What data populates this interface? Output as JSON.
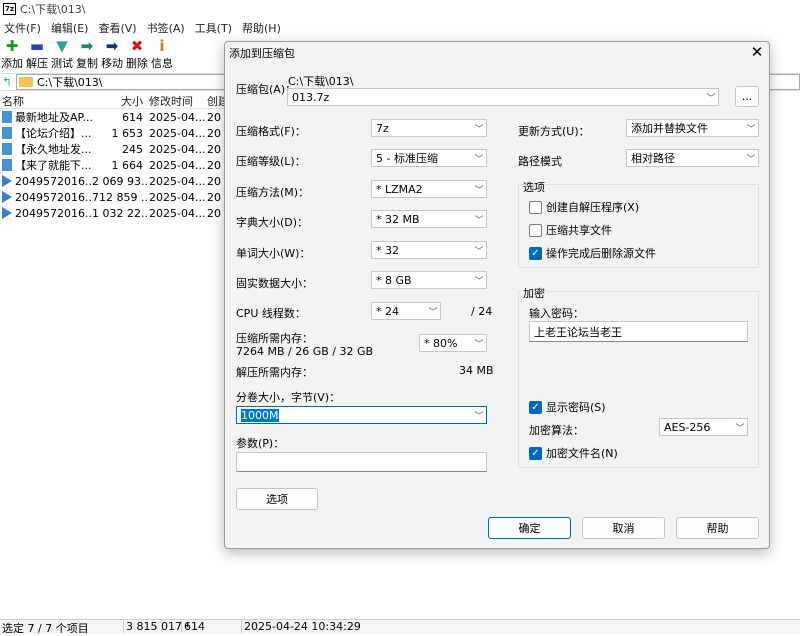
{
  "window": {
    "icon_label": "7z",
    "title": "C:\\下载\\013\\"
  },
  "menu": [
    "文件(F)",
    "编辑(E)",
    "查看(V)",
    "书签(A)",
    "工具(T)",
    "帮助(H)"
  ],
  "toolbar": [
    {
      "label": "添加",
      "glyph": "✚",
      "color": "#1a9e1a",
      "icon": "add-icon"
    },
    {
      "label": "解压",
      "glyph": "▬",
      "color": "#2a3fb0",
      "icon": "extract-icon"
    },
    {
      "label": "测试",
      "glyph": "▼",
      "color": "#2aa0a0",
      "icon": "test-icon"
    },
    {
      "label": "复制",
      "glyph": "➡",
      "color": "#1a8a6a",
      "icon": "copy-icon"
    },
    {
      "label": "移动",
      "glyph": "➡",
      "color": "#1a2a90",
      "icon": "move-icon"
    },
    {
      "label": "删除",
      "glyph": "✖",
      "color": "#d11a1a",
      "icon": "delete-icon"
    },
    {
      "label": "信息",
      "glyph": "i",
      "color": "#b8860b",
      "icon": "info-icon"
    }
  ],
  "address": {
    "path": "C:\\下载\\013\\"
  },
  "filelist": {
    "headers": [
      "名称",
      "大小",
      "修改时间",
      "创建"
    ],
    "rows": [
      {
        "name": "最新地址及AP...",
        "size": "614",
        "modified": "2025-04...",
        "created": "20",
        "type": "doc"
      },
      {
        "name": "【论坛介绍】....",
        "size": "1 653",
        "modified": "2025-04...",
        "created": "20",
        "type": "doc"
      },
      {
        "name": "【永久地址发...",
        "size": "245",
        "modified": "2025-04...",
        "created": "20",
        "type": "doc"
      },
      {
        "name": "【来了就能下...",
        "size": "1 664",
        "modified": "2025-04...",
        "created": "20",
        "type": "doc"
      },
      {
        "name": "2049572016...",
        "size": "2 069 93...",
        "modified": "2025-04...",
        "created": "20",
        "type": "vid"
      },
      {
        "name": "2049572016...",
        "size": "712 859 ...",
        "modified": "2025-04...",
        "created": "20",
        "type": "vid"
      },
      {
        "name": "2049572016...",
        "size": "1 032 22...",
        "modified": "2025-04...",
        "created": "20",
        "type": "vid"
      }
    ]
  },
  "status": {
    "selected": "选定 7 / 7 个项目",
    "total_size": "3 815 017 !",
    "size2": "614",
    "datetime": "2025-04-24 10:34:29"
  },
  "dialog": {
    "title": "添加到压缩包",
    "archive_label": "压缩包(A)：",
    "archive_dir": "C:\\下载\\013\\",
    "archive_name": "013.7z",
    "browse_label": "...",
    "format_label": "压缩格式(F)：",
    "format_value": "7z",
    "level_label": "压缩等级(L)：",
    "level_value": "5 - 标准压缩",
    "method_label": "压缩方法(M)：",
    "method_value": "* LZMA2",
    "dict_label": "字典大小(D)：",
    "dict_value": "* 32 MB",
    "word_label": "单词大小(W)：",
    "word_value": "* 32",
    "solid_label": "固实数据大小：",
    "solid_value": "* 8 GB",
    "cpu_label": "CPU 线程数：",
    "cpu_value": "* 24",
    "cpu_total": "/ 24",
    "mem_label": "压缩所需内存：",
    "mem_value": "7264 MB / 26 GB / 32 GB",
    "mem_percent": "* 80%",
    "demem_label": "解压所需内存：",
    "demem_value": "34 MB",
    "split_label": "分卷大小，字节(V)：",
    "split_value": "1000M",
    "params_label": "参数(P)：",
    "params_value": "",
    "options_button": "选项",
    "update_label": "更新方式(U)：",
    "update_value": "添加并替换文件",
    "path_label": "路径模式",
    "path_value": "相对路径",
    "options_group": "选项",
    "opt_sfx": "创建自解压程序(X)",
    "opt_shared": "压缩共享文件",
    "opt_delete": "操作完成后删除源文件",
    "enc_group": "加密",
    "password_label": "输入密码：",
    "password_value": "上老王论坛当老王",
    "show_password": "显示密码(S)",
    "enc_method_label": "加密算法：",
    "enc_method_value": "AES-256",
    "enc_names": "加密文件名(N)",
    "ok": "确定",
    "cancel": "取消",
    "help": "帮助"
  }
}
